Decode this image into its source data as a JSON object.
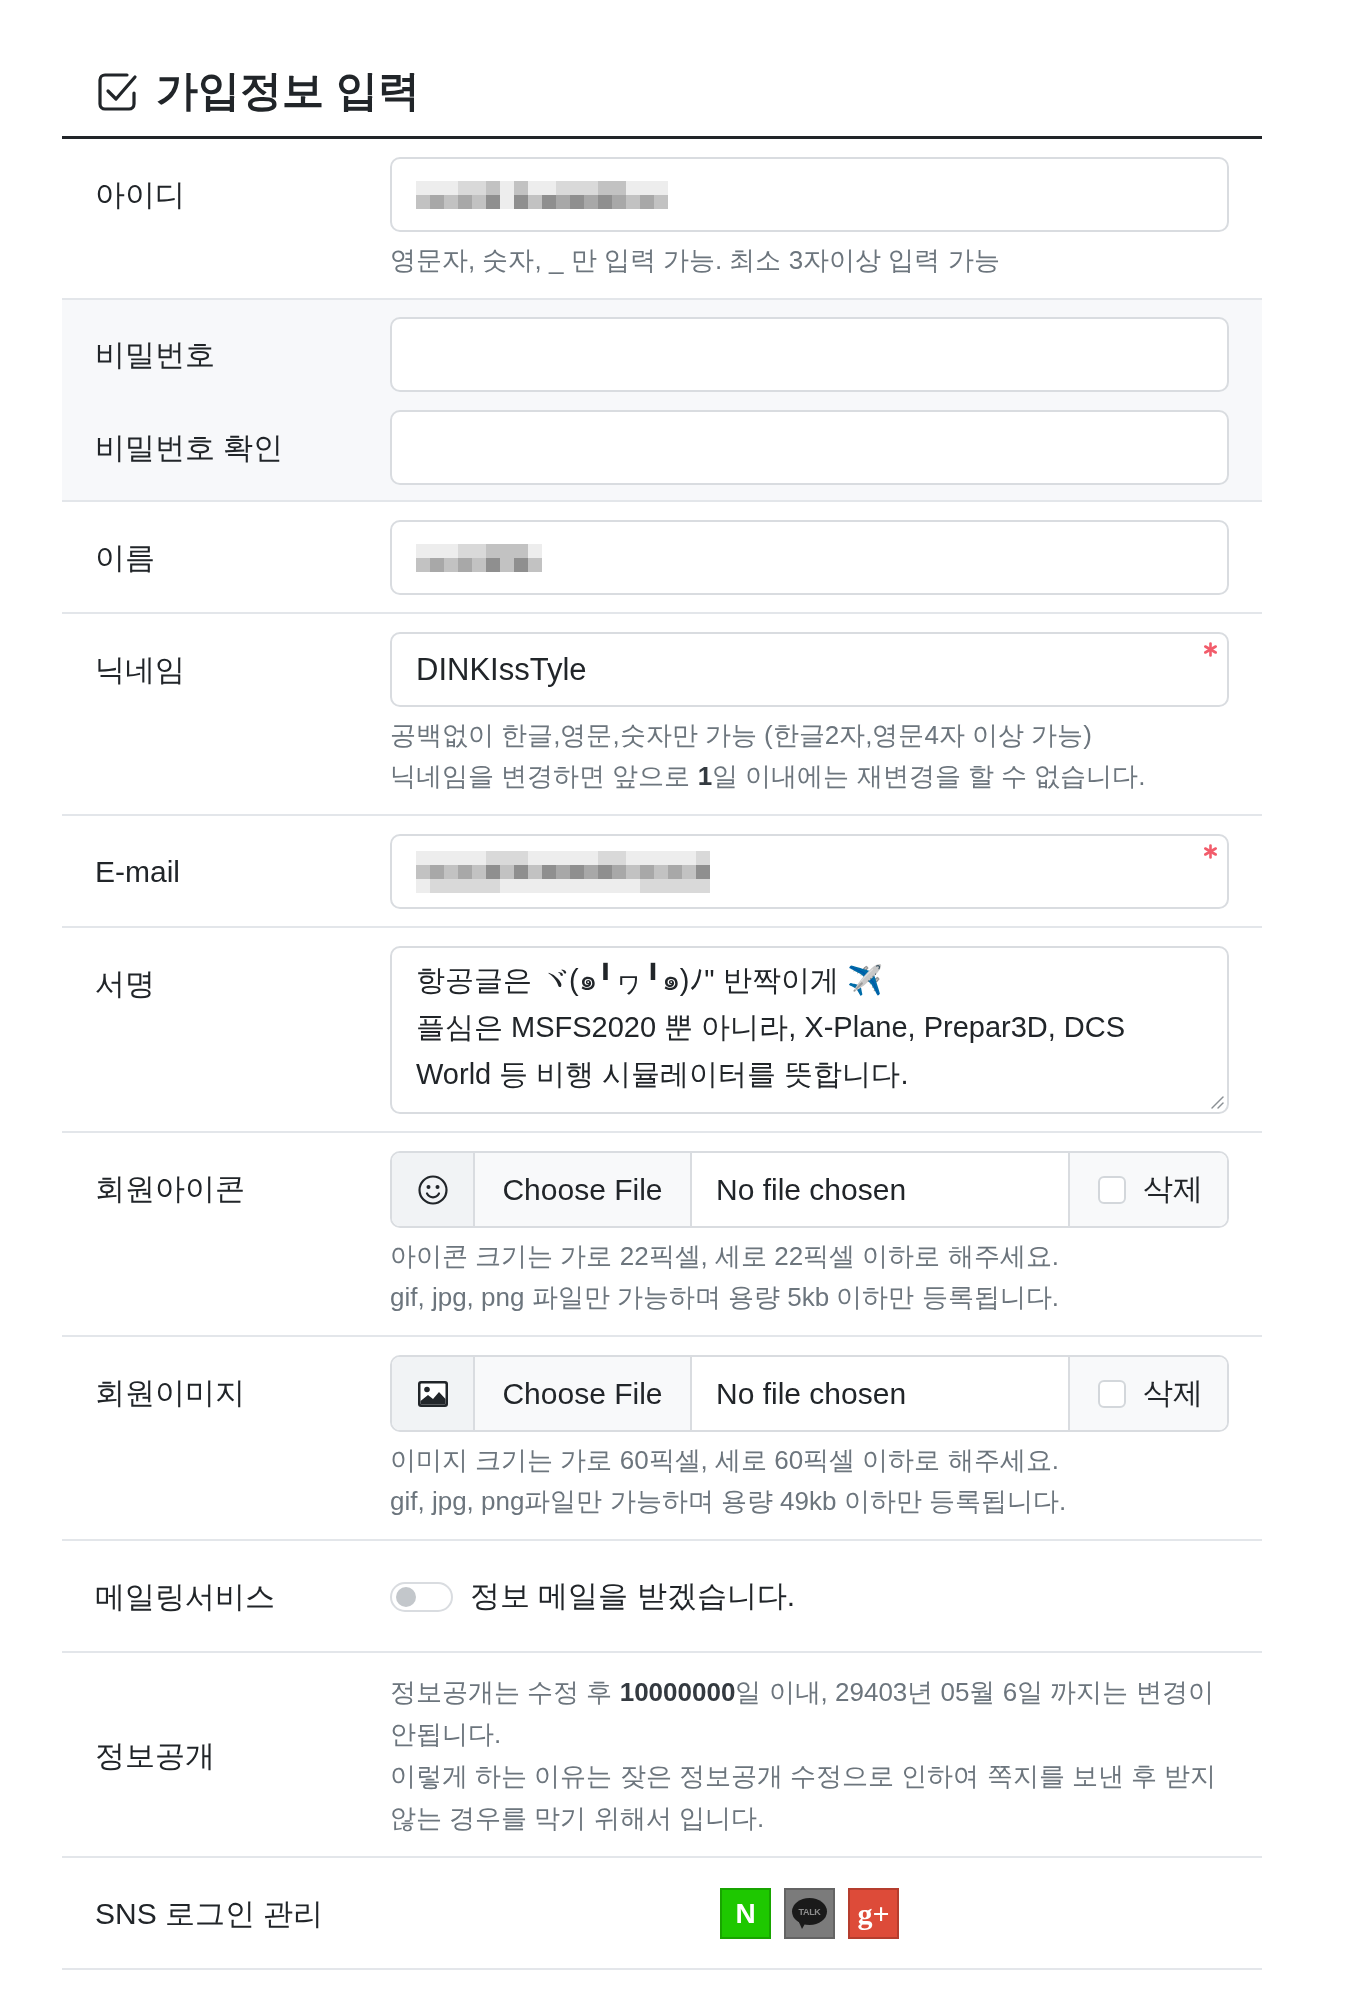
{
  "heading": {
    "title": "가입정보 입력"
  },
  "rows": [
    {
      "kind": "text",
      "label": "아이디",
      "field": {
        "redacted": true,
        "required": false
      },
      "help": [
        "영문자, 숫자, _ 만 입력 가능. 최소 3자이상 입력 가능"
      ]
    },
    {
      "kind": "password",
      "fields": [
        {
          "label": "비밀번호"
        },
        {
          "label": "비밀번호 확인"
        }
      ]
    },
    {
      "kind": "text",
      "label": "이름",
      "field": {
        "redacted": true,
        "required": false
      }
    },
    {
      "kind": "text",
      "label": "닉네임",
      "field": {
        "value": "DINKIssTyle",
        "redacted": false,
        "required": true
      },
      "help": [
        "공백없이 한글,영문,숫자만 가능 (한글2자,영문4자 이상 가능)",
        "닉네임을 변경하면 앞으로 **1**일 이내에는 재변경을 할 수 없습니다."
      ]
    },
    {
      "kind": "text",
      "label": "E-mail",
      "field": {
        "redacted": true,
        "required": true
      }
    },
    {
      "kind": "textarea",
      "label": "서명",
      "lines": [
        "항공글은 ヾ(๑╹ヮ╹๑)ﾉ\" 반짝이게 ✈️",
        "플심은 MSFS2020 뿐 아니라, X-Plane, Prepar3D, DCS",
        "World 등 비행 시뮬레이터를 뜻합니다."
      ]
    },
    {
      "kind": "file",
      "label": "회원아이콘",
      "button": "Choose File",
      "file_name": "No file chosen",
      "delete": {
        "label": "삭제",
        "checked": false
      },
      "help": [
        "아이콘 크기는 가로 22픽셀, 세로 22픽셀 이하로 해주세요.",
        "gif, jpg, png 파일만 가능하며 용량 5kb 이하만 등록됩니다."
      ]
    },
    {
      "kind": "file",
      "label": "회원이미지",
      "button": "Choose File",
      "file_name": "No file chosen",
      "delete": {
        "label": "삭제",
        "checked": false
      },
      "help": [
        "이미지 크기는 가로 60픽셀, 세로 60픽셀 이하로 해주세요.",
        "gif, jpg, png파일만 가능하며 용량 49kb 이하만 등록됩니다."
      ]
    },
    {
      "kind": "switch",
      "label": "메일링서비스",
      "switch": {
        "on": false,
        "label": "정보 메일을 받겠습니다."
      }
    },
    {
      "kind": "notice",
      "label": "정보공개",
      "paragraphs": [
        "정보공개는 수정 후 **10000000**일 이내, 29403년 05월 6일 까지는 변경이 안됩니다.",
        "이렇게 하는 이유는 잦은 정보공개 수정으로 인하여 쪽지를 보낸 후 받지 않는 경우를 막기 위해서 입니다."
      ]
    },
    {
      "kind": "sns",
      "label": "SNS 로그인 관리",
      "buttons": [
        {
          "kind": "block",
          "text": "N",
          "color": "#1ec800"
        },
        {
          "kind": "bubble",
          "text": "TALK",
          "color": "#7b7b7b"
        },
        {
          "kind": "script",
          "text": "g+",
          "color": "#dd4b39"
        }
      ]
    }
  ]
}
